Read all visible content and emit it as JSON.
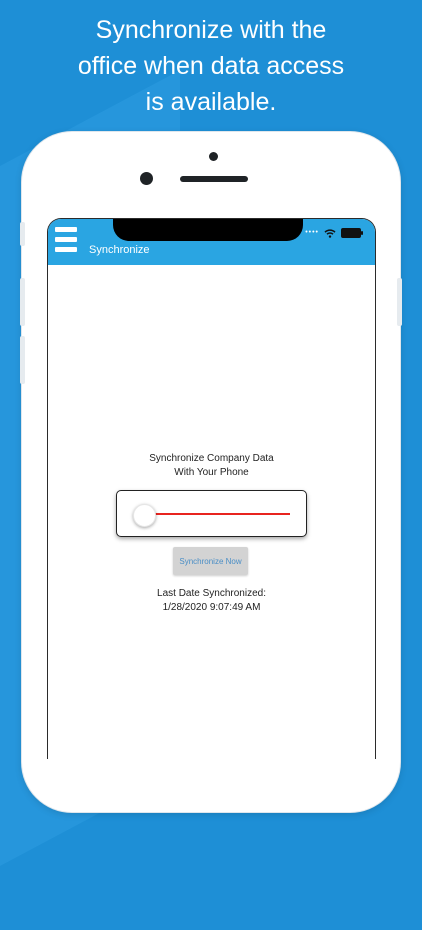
{
  "headline": {
    "line1": "Synchronize with the",
    "line2": "office when data access",
    "line3": "is available."
  },
  "status_bar": {
    "signal": "••••"
  },
  "app_bar": {
    "title": "Synchronize"
  },
  "main": {
    "prompt_line1": "Synchronize Company Data",
    "prompt_line2": "With Your Phone",
    "slider": {
      "value": 0.0
    },
    "sync_button_label": "Synchronize Now",
    "last_sync_label": "Last Date Synchronized:",
    "last_sync_value": "1/28/2020 9:07:49 AM"
  },
  "colors": {
    "background": "#1e8fd6",
    "app_bar": "#2aa5e2",
    "slider_track": "#e8241f",
    "button_text": "#4a8ec6"
  },
  "icons": [
    "menu-icon",
    "wifi-icon",
    "battery-icon"
  ]
}
